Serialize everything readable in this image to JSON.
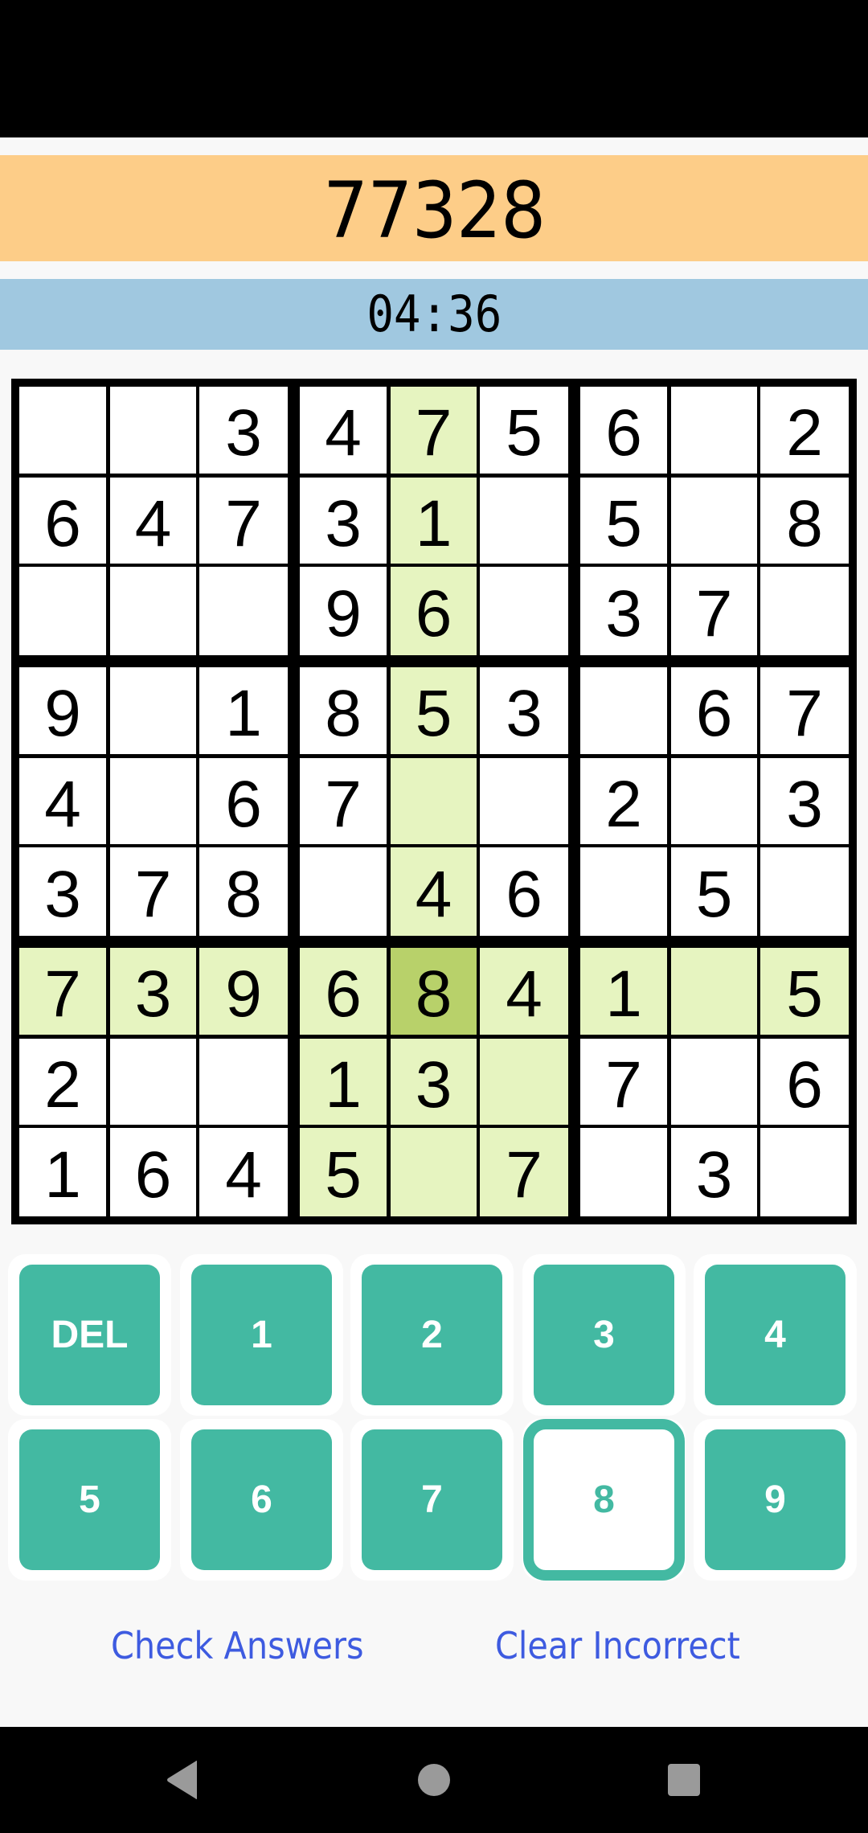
{
  "header": {
    "score": "77328",
    "timer": "04:36"
  },
  "colors": {
    "score_band": "#fdcd88",
    "timer_band": "#a0c8e0",
    "highlight": "#e6f4c0",
    "selected_cell": "#b8d16a",
    "keypad": "#43b9a2",
    "link": "#3e5be0"
  },
  "board": {
    "selected": {
      "row": 6,
      "col": 4
    },
    "rows": [
      [
        "",
        "",
        "3",
        "4",
        "7",
        "5",
        "6",
        "",
        "2"
      ],
      [
        "6",
        "4",
        "7",
        "3",
        "1",
        "",
        "5",
        "",
        "8"
      ],
      [
        "",
        "",
        "",
        "9",
        "6",
        "",
        "3",
        "7",
        ""
      ],
      [
        "9",
        "",
        "1",
        "8",
        "5",
        "3",
        "",
        "6",
        "7"
      ],
      [
        "4",
        "",
        "6",
        "7",
        "",
        "",
        "2",
        "",
        "3"
      ],
      [
        "3",
        "7",
        "8",
        "",
        "4",
        "6",
        "",
        "5",
        ""
      ],
      [
        "7",
        "3",
        "9",
        "6",
        "8",
        "4",
        "1",
        "",
        "5"
      ],
      [
        "2",
        "",
        "",
        "1",
        "3",
        "",
        "7",
        "",
        "6"
      ],
      [
        "1",
        "6",
        "4",
        "5",
        "",
        "7",
        "",
        "3",
        ""
      ]
    ]
  },
  "keypad": {
    "keys": [
      "DEL",
      "1",
      "2",
      "3",
      "4",
      "5",
      "6",
      "7",
      "8",
      "9"
    ],
    "active_key": "8"
  },
  "actions": {
    "check_answers": "Check Answers",
    "clear_incorrect": "Clear Incorrect"
  },
  "nav": {
    "back": "back-icon",
    "home": "home-icon",
    "recents": "recents-icon"
  }
}
